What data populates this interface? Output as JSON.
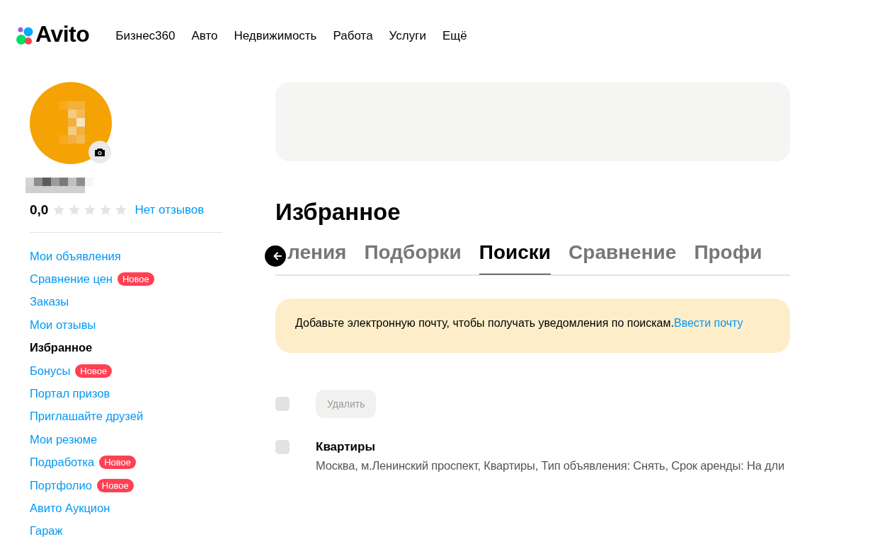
{
  "header": {
    "logo": "Avito",
    "nav": [
      "Бизнес360",
      "Авто",
      "Недвижимость",
      "Работа",
      "Услуги",
      "Ещё"
    ]
  },
  "profile": {
    "rating": "0,0",
    "stars": 0,
    "reviews_link": "Нет отзывов"
  },
  "sidebar": {
    "items": [
      {
        "label": "Мои объявления",
        "selected": false
      },
      {
        "label": "Сравнение цен",
        "selected": false,
        "badge": "Новое"
      },
      {
        "label": "Заказы",
        "selected": false
      },
      {
        "label": "Мои отзывы",
        "selected": false
      },
      {
        "label": "Избранное",
        "selected": true
      },
      {
        "label": "Бонусы",
        "selected": false,
        "badge": "Новое"
      },
      {
        "label": "Портал призов",
        "selected": false
      },
      {
        "label": "Приглашайте друзей",
        "selected": false
      },
      {
        "label": "Мои резюме",
        "selected": false
      },
      {
        "label": "Подработка",
        "selected": false,
        "badge": "Новое"
      },
      {
        "label": "Портфолио",
        "selected": false,
        "badge": "Новое"
      },
      {
        "label": "Авито Аукцион",
        "selected": false
      },
      {
        "label": "Гараж",
        "selected": false
      }
    ]
  },
  "page_title": "Избранное",
  "tabs": [
    {
      "label": "ления",
      "selected": false
    },
    {
      "label": "Подборки",
      "selected": false
    },
    {
      "label": "Поиски",
      "selected": true
    },
    {
      "label": "Сравнение",
      "selected": false
    },
    {
      "label": "Профи",
      "selected": false
    }
  ],
  "notice": {
    "text": "Добавьте электронную почту, чтобы получать уведомления по поискам.",
    "link": "Ввести почту"
  },
  "toolbar": {
    "select_all_checked": false,
    "delete_button": "Удалить",
    "delete_disabled": true
  },
  "searches": [
    {
      "title": "Квартиры",
      "checked": false,
      "description": "Москва, м.Ленинский проспект, Квартиры, Тип объявления: Снять, Срок аренды: На дли"
    }
  ]
}
